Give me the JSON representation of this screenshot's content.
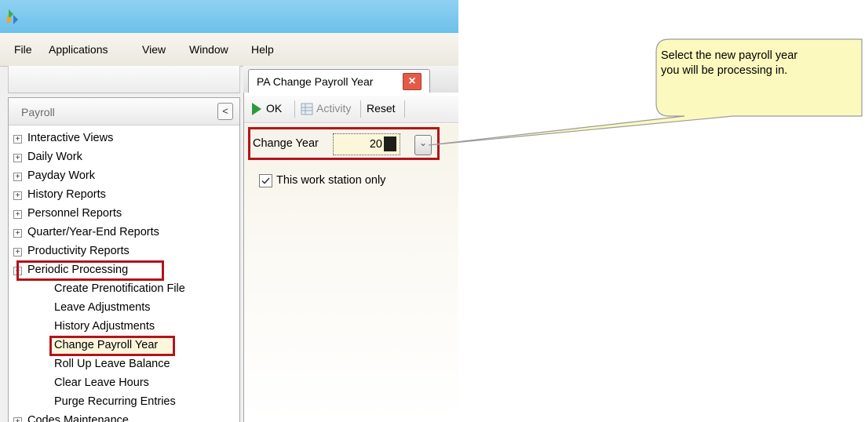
{
  "menu": {
    "file": "File",
    "applications": "Applications",
    "view": "View",
    "window": "Window",
    "help": "Help"
  },
  "tab": {
    "label": "PA Change Payroll Year"
  },
  "sidebar": {
    "title": "Payroll",
    "collapse_glyph": "<",
    "items": [
      {
        "label": "Interactive Views",
        "expander": "+"
      },
      {
        "label": "Daily Work",
        "expander": "+"
      },
      {
        "label": "Payday Work",
        "expander": "+"
      },
      {
        "label": "History Reports",
        "expander": "+"
      },
      {
        "label": "Personnel Reports",
        "expander": "+"
      },
      {
        "label": "Quarter/Year-End Reports",
        "expander": "+"
      },
      {
        "label": "Productivity Reports",
        "expander": "+"
      },
      {
        "label": "Periodic Processing",
        "expander": "−"
      },
      {
        "label": "Create Prenotification File"
      },
      {
        "label": "Leave Adjustments"
      },
      {
        "label": "History Adjustments"
      },
      {
        "label": "Change Payroll Year"
      },
      {
        "label": "Roll Up Leave Balance"
      },
      {
        "label": "Clear Leave Hours"
      },
      {
        "label": "Purge Recurring Entries"
      },
      {
        "label": "Codes Maintenance",
        "expander": "+"
      }
    ]
  },
  "toolbar": {
    "ok_label": "OK",
    "activity_label": "Activity",
    "reset_label": "Reset"
  },
  "form": {
    "change_year_label": "Change Year",
    "change_year_value": "20",
    "workstation_label": "This work station only",
    "workstation_checked": true
  },
  "callout": {
    "line1": "Select the new payroll year",
    "line2": "you will be processing in."
  }
}
